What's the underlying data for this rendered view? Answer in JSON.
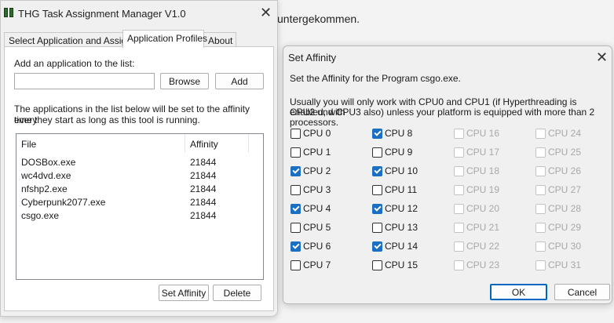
{
  "background": {
    "text": "untergekommen."
  },
  "main_window": {
    "title": "THG Task Assignment Manager V1.0",
    "close_glyph": "✕",
    "tabs": [
      {
        "label": "Select Application and Assign",
        "active": false
      },
      {
        "label": "Application Profiles",
        "active": true
      },
      {
        "label": "About",
        "active": false
      }
    ],
    "add_label": "Add an application to the list:",
    "add_input": {
      "value": "",
      "placeholder": ""
    },
    "browse_button": "Browse",
    "add_button": "Add",
    "info_line1": "The applications in the list below will be set to the affinity every",
    "info_line2": "time they start as long as this tool is running.",
    "list": {
      "columns": [
        "File",
        "Affinity"
      ],
      "rows": [
        {
          "file": "DOSBox.exe",
          "affinity": "21844"
        },
        {
          "file": "wc4dvd.exe",
          "affinity": "21844"
        },
        {
          "file": "nfshp2.exe",
          "affinity": "21844"
        },
        {
          "file": "Cyberpunk2077.exe",
          "affinity": "21844"
        },
        {
          "file": "csgo.exe",
          "affinity": "21844"
        }
      ]
    },
    "set_affinity_button": "Set Affinity",
    "delete_button": "Delete"
  },
  "affinity_dialog": {
    "title": "Set Affinity",
    "close_glyph": "✕",
    "program_text": "Set the Affinity for the Program csgo.exe.",
    "note_line1": "Usually you will only work with CPU0 and CPU1 (if Hyperthreading is enabled, with",
    "note_line2": "CPU2 und CPU3 also) unless your platform is equipped with more than 2 processors.",
    "cpus": [
      {
        "label": "CPU 0",
        "checked": false,
        "enabled": true
      },
      {
        "label": "CPU 1",
        "checked": false,
        "enabled": true
      },
      {
        "label": "CPU 2",
        "checked": true,
        "enabled": true
      },
      {
        "label": "CPU 3",
        "checked": false,
        "enabled": true
      },
      {
        "label": "CPU 4",
        "checked": true,
        "enabled": true
      },
      {
        "label": "CPU 5",
        "checked": false,
        "enabled": true
      },
      {
        "label": "CPU 6",
        "checked": true,
        "enabled": true
      },
      {
        "label": "CPU 7",
        "checked": false,
        "enabled": true
      },
      {
        "label": "CPU 8",
        "checked": true,
        "enabled": true
      },
      {
        "label": "CPU 9",
        "checked": false,
        "enabled": true
      },
      {
        "label": "CPU 10",
        "checked": true,
        "enabled": true
      },
      {
        "label": "CPU 11",
        "checked": false,
        "enabled": true
      },
      {
        "label": "CPU 12",
        "checked": true,
        "enabled": true
      },
      {
        "label": "CPU 13",
        "checked": false,
        "enabled": true
      },
      {
        "label": "CPU 14",
        "checked": true,
        "enabled": true
      },
      {
        "label": "CPU 15",
        "checked": false,
        "enabled": true
      },
      {
        "label": "CPU 16",
        "checked": false,
        "enabled": false
      },
      {
        "label": "CPU 17",
        "checked": false,
        "enabled": false
      },
      {
        "label": "CPU 18",
        "checked": false,
        "enabled": false
      },
      {
        "label": "CPU 19",
        "checked": false,
        "enabled": false
      },
      {
        "label": "CPU 20",
        "checked": false,
        "enabled": false
      },
      {
        "label": "CPU 21",
        "checked": false,
        "enabled": false
      },
      {
        "label": "CPU 22",
        "checked": false,
        "enabled": false
      },
      {
        "label": "CPU 23",
        "checked": false,
        "enabled": false
      },
      {
        "label": "CPU 24",
        "checked": false,
        "enabled": false
      },
      {
        "label": "CPU 25",
        "checked": false,
        "enabled": false
      },
      {
        "label": "CPU 26",
        "checked": false,
        "enabled": false
      },
      {
        "label": "CPU 27",
        "checked": false,
        "enabled": false
      },
      {
        "label": "CPU 28",
        "checked": false,
        "enabled": false
      },
      {
        "label": "CPU 29",
        "checked": false,
        "enabled": false
      },
      {
        "label": "CPU 30",
        "checked": false,
        "enabled": false
      },
      {
        "label": "CPU 31",
        "checked": false,
        "enabled": false
      }
    ],
    "ok_button": "OK",
    "cancel_button": "Cancel"
  }
}
